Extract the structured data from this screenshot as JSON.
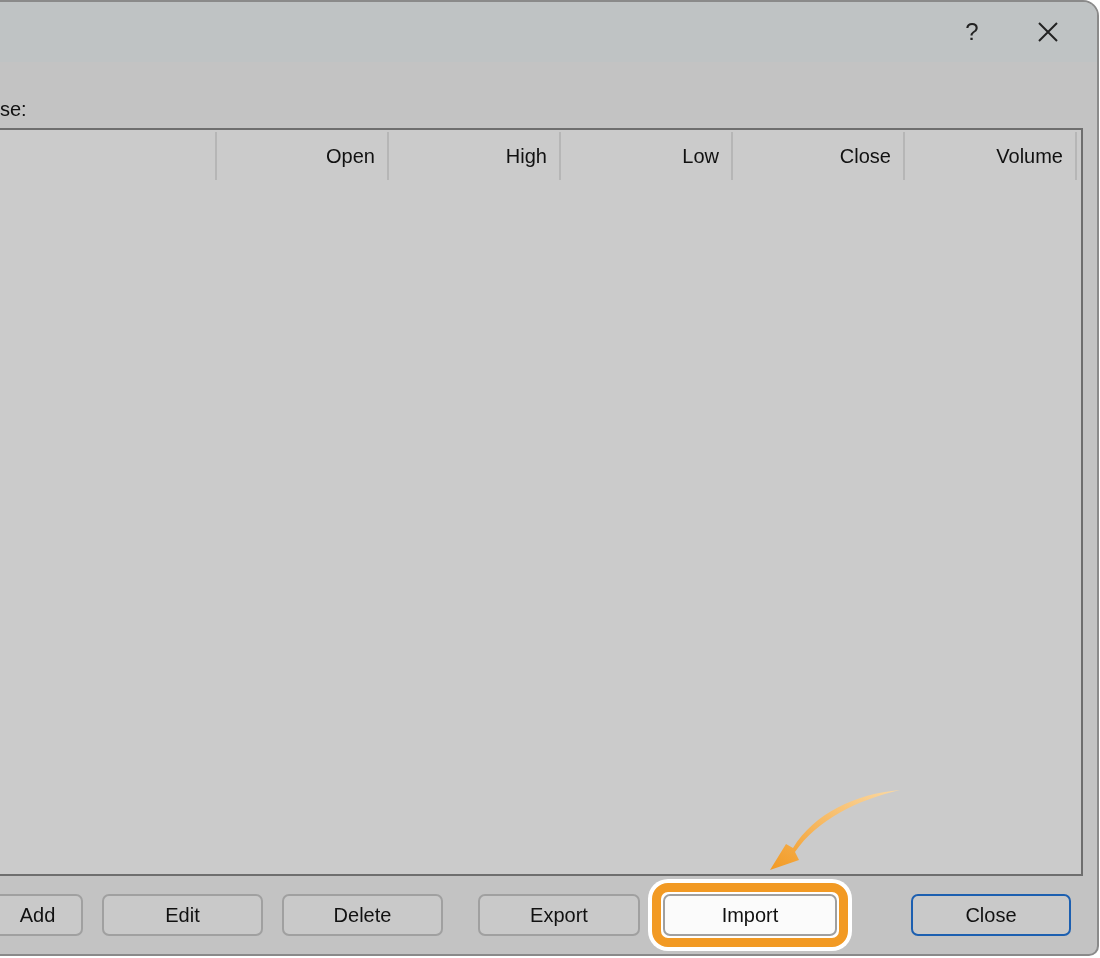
{
  "window": {
    "help_button": "?"
  },
  "label": "se:",
  "table": {
    "columns": [
      {
        "label": "Open"
      },
      {
        "label": "High"
      },
      {
        "label": "Low"
      },
      {
        "label": "Close"
      },
      {
        "label": "Volume"
      }
    ]
  },
  "buttons": [
    {
      "label": "Add",
      "kind": "plain",
      "highlighted": false
    },
    {
      "label": "Edit",
      "kind": "plain",
      "highlighted": false
    },
    {
      "label": "Delete",
      "kind": "plain",
      "highlighted": false
    },
    {
      "label": "Export",
      "kind": "plain",
      "highlighted": false
    },
    {
      "label": "Import",
      "kind": "plain",
      "highlighted": true
    },
    {
      "label": "Close",
      "kind": "default",
      "highlighted": false
    }
  ]
}
